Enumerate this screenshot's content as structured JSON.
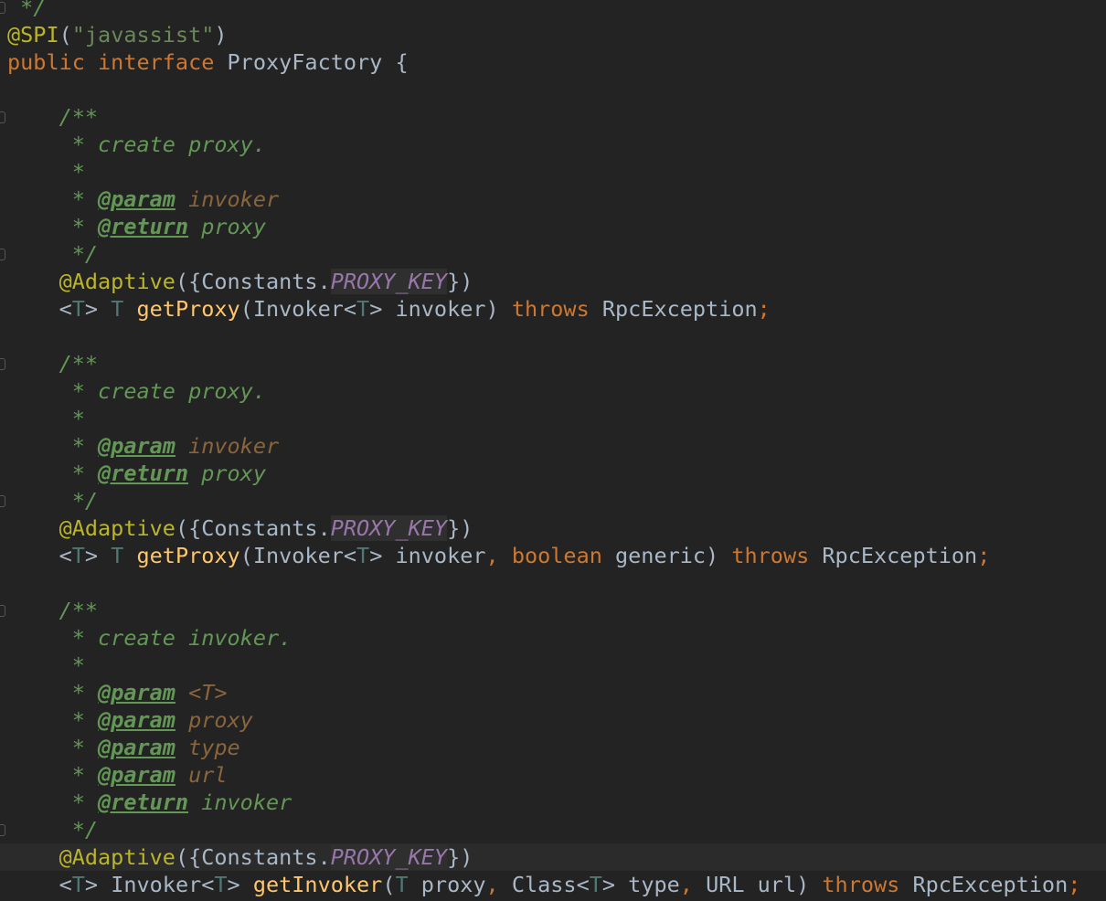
{
  "colors": {
    "background": "#232323",
    "keyword": "#cc7832",
    "text": "#a9b7c6",
    "annotation": "#bbb529",
    "string": "#6a8759",
    "comment": "#629755",
    "param": "#8a653b",
    "method": "#ffc66d",
    "constant": "#9876aa",
    "type_param": "#507874"
  },
  "current_line": 31,
  "fold_lines": [
    0,
    4,
    9,
    13,
    18,
    22,
    30
  ],
  "lines": [
    [
      [
        "cm",
        " */"
      ]
    ],
    [
      [
        "ann",
        "@SPI"
      ],
      [
        "id",
        "("
      ],
      [
        "str",
        "\"javassist\""
      ],
      [
        "id",
        ")"
      ]
    ],
    [
      [
        "kw",
        "public interface "
      ],
      [
        "id",
        "ProxyFactory {"
      ]
    ],
    [],
    [
      [
        "cm",
        "    /**"
      ]
    ],
    [
      [
        "cm",
        "     * create proxy."
      ]
    ],
    [
      [
        "cm",
        "     *"
      ]
    ],
    [
      [
        "cm",
        "     * "
      ],
      [
        "tag",
        "@param"
      ],
      [
        "cm",
        " "
      ],
      [
        "prm",
        "invoker"
      ]
    ],
    [
      [
        "cm",
        "     * "
      ],
      [
        "tag",
        "@return"
      ],
      [
        "cm",
        " proxy"
      ]
    ],
    [
      [
        "cm",
        "     */"
      ]
    ],
    [
      [
        "ann",
        "    @Adaptive"
      ],
      [
        "id",
        "({Constants."
      ],
      [
        "cst",
        "PROXY_KEY"
      ],
      [
        "id",
        "})"
      ]
    ],
    [
      [
        "id",
        "    <"
      ],
      [
        "tp",
        "T"
      ],
      [
        "id",
        "> "
      ],
      [
        "tp",
        "T "
      ],
      [
        "fn",
        "getProxy"
      ],
      [
        "id",
        "(Invoker<"
      ],
      [
        "tp",
        "T"
      ],
      [
        "id",
        "> invoker) "
      ],
      [
        "kw",
        "throws "
      ],
      [
        "id",
        "RpcException"
      ],
      [
        "kw",
        ";"
      ]
    ],
    [],
    [
      [
        "cm",
        "    /**"
      ]
    ],
    [
      [
        "cm",
        "     * create proxy."
      ]
    ],
    [
      [
        "cm",
        "     *"
      ]
    ],
    [
      [
        "cm",
        "     * "
      ],
      [
        "tag",
        "@param"
      ],
      [
        "cm",
        " "
      ],
      [
        "prm",
        "invoker"
      ]
    ],
    [
      [
        "cm",
        "     * "
      ],
      [
        "tag",
        "@return"
      ],
      [
        "cm",
        " proxy"
      ]
    ],
    [
      [
        "cm",
        "     */"
      ]
    ],
    [
      [
        "ann",
        "    @Adaptive"
      ],
      [
        "id",
        "({Constants."
      ],
      [
        "cst",
        "PROXY_KEY"
      ],
      [
        "id",
        "})"
      ]
    ],
    [
      [
        "id",
        "    <"
      ],
      [
        "tp",
        "T"
      ],
      [
        "id",
        "> "
      ],
      [
        "tp",
        "T "
      ],
      [
        "fn",
        "getProxy"
      ],
      [
        "id",
        "(Invoker<"
      ],
      [
        "tp",
        "T"
      ],
      [
        "id",
        "> invoker"
      ],
      [
        "kw",
        ", boolean "
      ],
      [
        "id",
        "generic) "
      ],
      [
        "kw",
        "throws "
      ],
      [
        "id",
        "RpcException"
      ],
      [
        "kw",
        ";"
      ]
    ],
    [],
    [
      [
        "cm",
        "    /**"
      ]
    ],
    [
      [
        "cm",
        "     * create invoker."
      ]
    ],
    [
      [
        "cm",
        "     *"
      ]
    ],
    [
      [
        "cm",
        "     * "
      ],
      [
        "tag",
        "@param"
      ],
      [
        "cm",
        " "
      ],
      [
        "prm",
        "<T>"
      ]
    ],
    [
      [
        "cm",
        "     * "
      ],
      [
        "tag",
        "@param"
      ],
      [
        "cm",
        " "
      ],
      [
        "prm",
        "proxy"
      ]
    ],
    [
      [
        "cm",
        "     * "
      ],
      [
        "tag",
        "@param"
      ],
      [
        "cm",
        " "
      ],
      [
        "prm",
        "type"
      ]
    ],
    [
      [
        "cm",
        "     * "
      ],
      [
        "tag",
        "@param"
      ],
      [
        "cm",
        " "
      ],
      [
        "prm",
        "url"
      ]
    ],
    [
      [
        "cm",
        "     * "
      ],
      [
        "tag",
        "@return"
      ],
      [
        "cm",
        " invoker"
      ]
    ],
    [
      [
        "cm",
        "     */"
      ]
    ],
    [
      [
        "ann",
        "    @Adaptive"
      ],
      [
        "id",
        "({Constants."
      ],
      [
        "cst",
        "PROXY_KEY"
      ],
      [
        "id",
        "})"
      ]
    ],
    [
      [
        "id",
        "    <"
      ],
      [
        "tp",
        "T"
      ],
      [
        "id",
        "> Invoker<"
      ],
      [
        "tp",
        "T"
      ],
      [
        "id",
        "> "
      ],
      [
        "fn",
        "getInvoker"
      ],
      [
        "id",
        "("
      ],
      [
        "tp",
        "T "
      ],
      [
        "id",
        "proxy"
      ],
      [
        "kw",
        ", "
      ],
      [
        "id",
        "Class<"
      ],
      [
        "tp",
        "T"
      ],
      [
        "id",
        "> type"
      ],
      [
        "kw",
        ", "
      ],
      [
        "id",
        "URL url) "
      ],
      [
        "kw",
        "throws "
      ],
      [
        "id",
        "RpcException"
      ],
      [
        "kw",
        ";"
      ]
    ]
  ]
}
